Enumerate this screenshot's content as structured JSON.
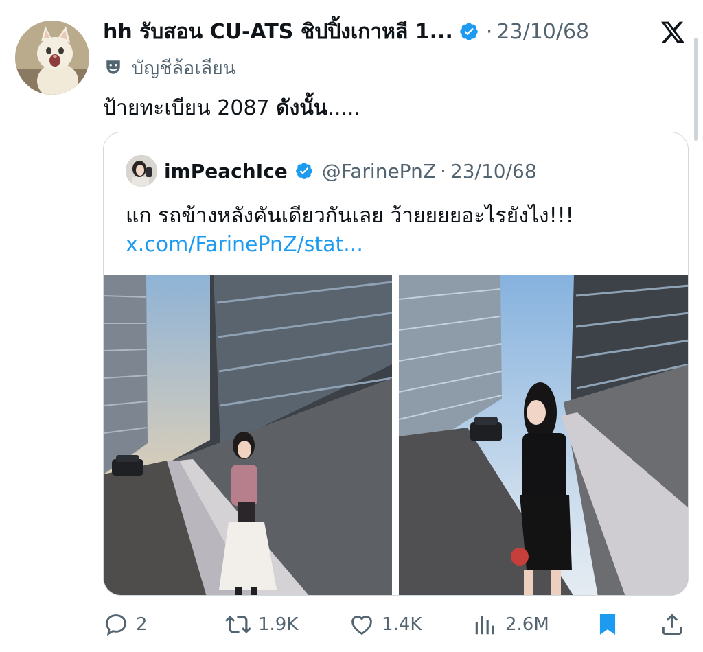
{
  "tweet": {
    "display_name": "hh รับสอน CU-ATS ชิปปิ้งเกาหลี 1...",
    "separator": "·",
    "date": "23/10/68",
    "parody_label": "บัญชีล้อเลียน",
    "text_plain": "ป้ายทะเบียน 2087 ",
    "text_bold": "ดังนั้น",
    "text_tail": ".....",
    "icons": {
      "verified": "verified-badge-icon",
      "parody": "parody-mask-icon",
      "platform": "x-logo-icon"
    }
  },
  "quote": {
    "display_name": "imPeachIce",
    "handle": "@FarinePnZ",
    "separator": "·",
    "date": "23/10/68",
    "text": "แก รถข้างหลังคันเดียวกันเลย ว้ายยยยอะไรยังไง!!!",
    "link": "x.com/FarinePnZ/stat..."
  },
  "actions": {
    "replies": "2",
    "reposts": "1.9K",
    "likes": "1.4K",
    "views": "2.6M",
    "bookmark_state": "bookmarked",
    "icons": [
      "reply-icon",
      "repost-icon",
      "like-icon",
      "views-icon",
      "bookmark-icon",
      "share-icon"
    ]
  },
  "colors": {
    "text_primary": "#0f1419",
    "text_secondary": "#536471",
    "link": "#1d9bf0",
    "verified": "#1d9bf0",
    "bookmark": "#1d9bf0",
    "border": "#cfd9de"
  }
}
